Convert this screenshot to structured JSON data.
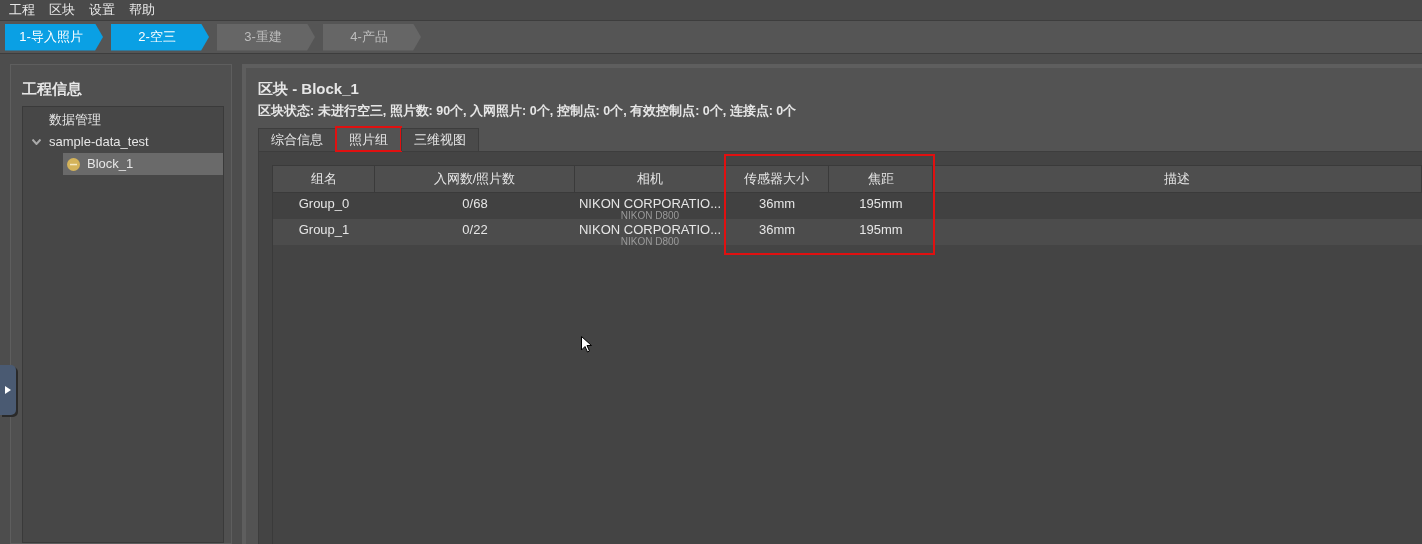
{
  "menu": [
    "工程",
    "区块",
    "设置",
    "帮助"
  ],
  "steps": [
    {
      "label": "1-导入照片",
      "selected": true
    },
    {
      "label": "2-空三",
      "selected": true
    },
    {
      "label": "3-重建",
      "selected": false
    },
    {
      "label": "4-产品",
      "selected": false
    }
  ],
  "sidebar": {
    "title": "工程信息",
    "tree": [
      {
        "label": "数据管理"
      },
      {
        "label": "sample-data_test",
        "expanded": true,
        "children": [
          {
            "label": "Block_1",
            "selected": true,
            "color": "#d4b35a"
          }
        ]
      }
    ]
  },
  "block": {
    "title": "区块 - Block_1",
    "status": "区块状态: 未进行空三, 照片数: 90个, 入网照片: 0个, 控制点: 0个, 有效控制点: 0个, 连接点: 0个"
  },
  "tabs": [
    {
      "label": "综合信息",
      "selected": false,
      "highlighted": false
    },
    {
      "label": "照片组",
      "selected": true,
      "highlighted": true
    },
    {
      "label": "三维视图",
      "selected": false,
      "highlighted": false
    }
  ],
  "table": {
    "columns": [
      {
        "label": "组名",
        "highlighted": false
      },
      {
        "label": "入网数/照片数",
        "highlighted": false
      },
      {
        "label": "相机",
        "highlighted": false
      },
      {
        "label": "传感器大小",
        "highlighted": true
      },
      {
        "label": "焦距",
        "highlighted": true
      },
      {
        "label": "描述",
        "highlighted": false
      }
    ],
    "rows": [
      {
        "cells": [
          "Group_0",
          "0/68",
          "NIKON CORPORATIO...",
          "36mm",
          "195mm",
          ""
        ],
        "camera_line_2": "NIKON D800"
      },
      {
        "cells": [
          "Group_1",
          "0/22",
          "NIKON CORPORATIO...",
          "36mm",
          "195mm",
          ""
        ],
        "camera_line_2": "NIKON D800"
      }
    ]
  }
}
